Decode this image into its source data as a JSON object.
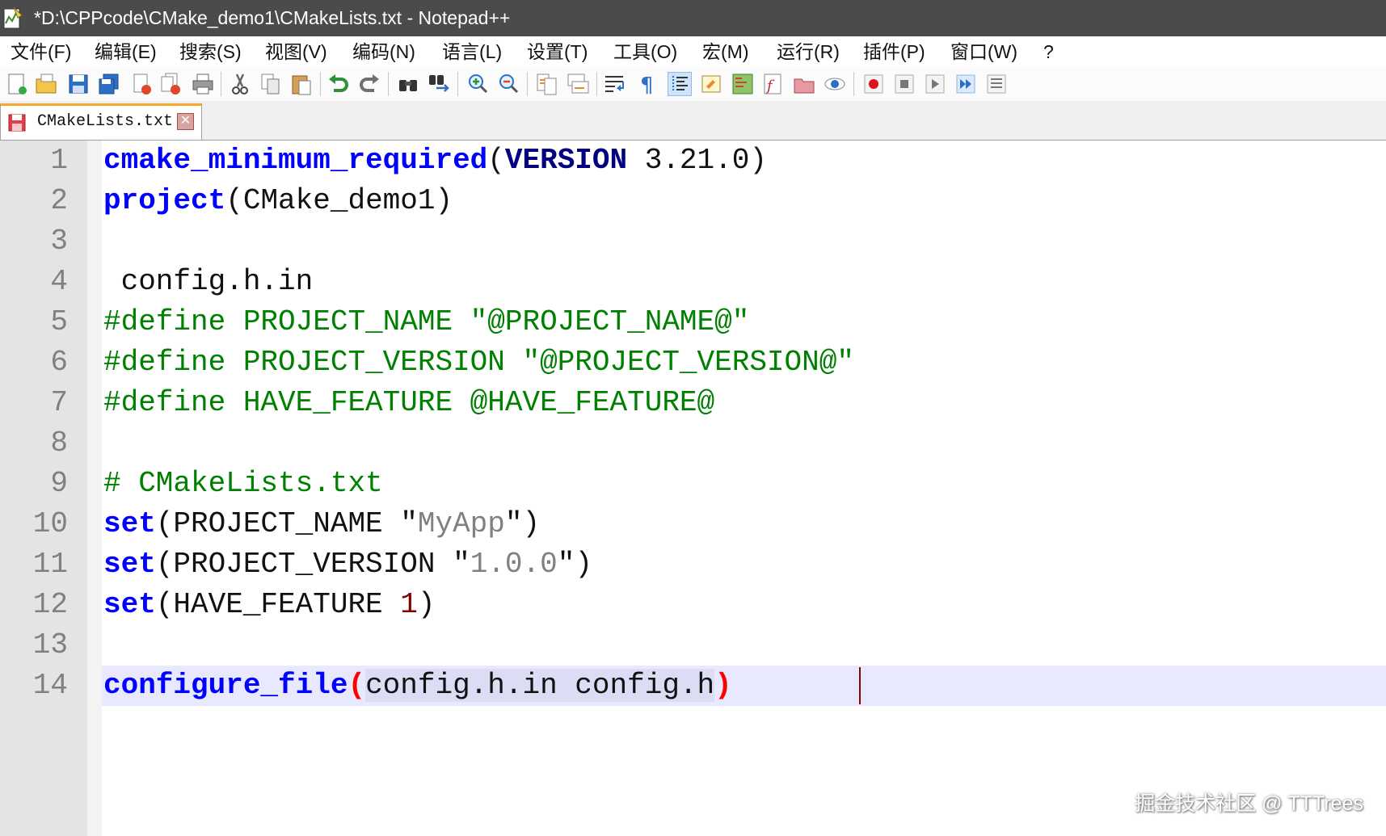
{
  "window": {
    "title": "*D:\\CPPcode\\CMake_demo1\\CMakeLists.txt - Notepad++"
  },
  "menu": [
    "文件(F)",
    "编辑(E)",
    "搜索(S)",
    "视图(V)",
    "编码(N)",
    "语言(L)",
    "设置(T)",
    "工具(O)",
    "宏(M)",
    "运行(R)",
    "插件(P)",
    "窗口(W)",
    "?"
  ],
  "toolbar": {
    "icons": [
      "new-file-icon",
      "open-file-icon",
      "save-icon",
      "save-all-icon",
      "close-icon",
      "close-all-icon",
      "print-icon",
      "cut-icon",
      "copy-icon",
      "paste-icon",
      "undo-icon",
      "redo-icon",
      "find-icon",
      "replace-icon",
      "zoom-in-icon",
      "zoom-out-icon",
      "sync-vertical-icon",
      "sync-horizontal-icon",
      "word-wrap-icon",
      "show-all-characters-icon",
      "indent-guide-icon",
      "udl-icon",
      "doc-map-icon",
      "function-list-icon",
      "folder-workspace-icon",
      "monitoring-icon",
      "record-macro-icon",
      "stop-macro-icon",
      "play-macro-icon",
      "run-macro-multiple-icon",
      "save-macro-icon"
    ]
  },
  "tab": {
    "label": "CMakeLists.txt",
    "close_glyph": "✕"
  },
  "editor": {
    "line_numbers": [
      "1",
      "2",
      "3",
      "4",
      "5",
      "6",
      "7",
      "8",
      "9",
      "10",
      "11",
      "12",
      "13",
      "14"
    ],
    "lines": [
      [
        {
          "t": "cmake_minimum_required",
          "c": "kw"
        },
        {
          "t": "(",
          "c": ""
        },
        {
          "t": "VERSION",
          "c": "kw2"
        },
        {
          "t": " 3.21.0)",
          "c": ""
        }
      ],
      [
        {
          "t": "project",
          "c": "kw"
        },
        {
          "t": "(CMake_demo1)",
          "c": ""
        }
      ],
      [],
      [
        {
          "t": " config.h.in",
          "c": ""
        }
      ],
      [
        {
          "t": "#define PROJECT_NAME \"@PROJECT_NAME@\"",
          "c": "cmt"
        }
      ],
      [
        {
          "t": "#define PROJECT_VERSION \"@PROJECT_VERSION@\"",
          "c": "cmt"
        }
      ],
      [
        {
          "t": "#define HAVE_FEATURE @HAVE_FEATURE@",
          "c": "cmt"
        }
      ],
      [],
      [
        {
          "t": "# CMakeLists.txt",
          "c": "cmt"
        }
      ],
      [
        {
          "t": "set",
          "c": "kw"
        },
        {
          "t": "(PROJECT_NAME \"",
          "c": ""
        },
        {
          "t": "MyApp",
          "c": "str"
        },
        {
          "t": "\")",
          "c": ""
        }
      ],
      [
        {
          "t": "set",
          "c": "kw"
        },
        {
          "t": "(PROJECT_VERSION \"",
          "c": ""
        },
        {
          "t": "1.0.0",
          "c": "str"
        },
        {
          "t": "\")",
          "c": ""
        }
      ],
      [
        {
          "t": "set",
          "c": "kw"
        },
        {
          "t": "(HAVE_FEATURE ",
          "c": ""
        },
        {
          "t": "1",
          "c": "num"
        },
        {
          "t": ")",
          "c": ""
        }
      ],
      [],
      [
        {
          "t": "configure_file",
          "c": "kw"
        },
        {
          "t": "(",
          "c": "paren-hl"
        },
        {
          "t": "config.h.in config.h",
          "c": "brace-bg"
        },
        {
          "t": ")",
          "c": "paren-hl"
        }
      ]
    ]
  },
  "watermark": "掘金技术社区 @ TTTrees",
  "colors": {
    "titlebar": "#4b4b4b",
    "keyword": "#0000ff",
    "comment": "#008000",
    "string": "#808080",
    "number": "#800000",
    "caret_line": "#e8e8ff"
  }
}
